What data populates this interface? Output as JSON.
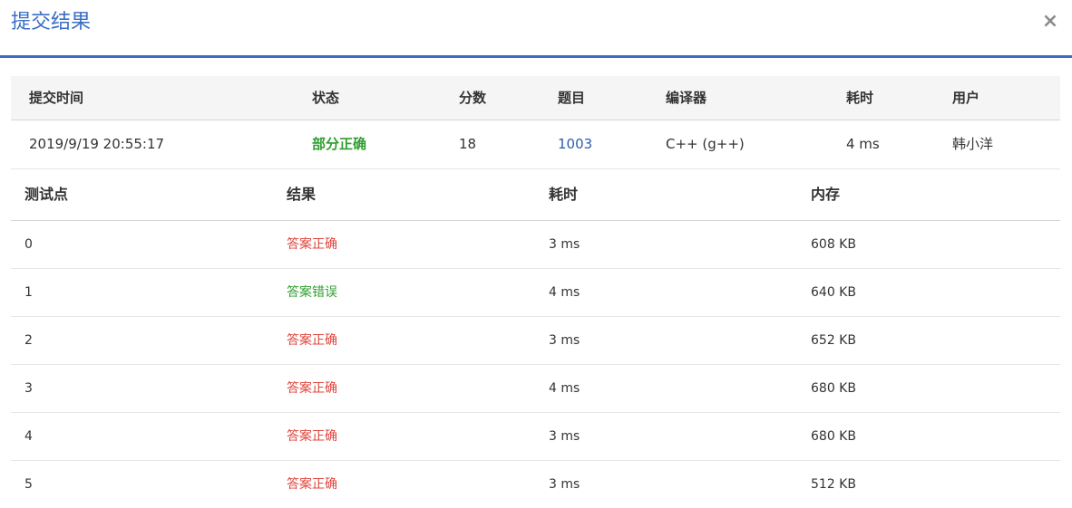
{
  "modal": {
    "title": "提交结果",
    "close": "×"
  },
  "summary": {
    "headers": [
      "提交时间",
      "状态",
      "分数",
      "题目",
      "编译器",
      "耗时",
      "用户"
    ],
    "row": {
      "time": "2019/9/19 20:55:17",
      "status": "部分正确",
      "score": "18",
      "problem": "1003",
      "compiler": "C++ (g++)",
      "elapsed": "4 ms",
      "user": "韩小洋"
    }
  },
  "cases": {
    "headers": [
      "测试点",
      "结果",
      "耗时",
      "内存"
    ],
    "rows": [
      {
        "id": "0",
        "result": "答案正确",
        "result_color": "#e0443b",
        "time": "3 ms",
        "memory": "608 KB"
      },
      {
        "id": "1",
        "result": "答案错误",
        "result_color": "#2f9e2f",
        "time": "4 ms",
        "memory": "640 KB"
      },
      {
        "id": "2",
        "result": "答案正确",
        "result_color": "#e0443b",
        "time": "3 ms",
        "memory": "652 KB"
      },
      {
        "id": "3",
        "result": "答案正确",
        "result_color": "#e0443b",
        "time": "4 ms",
        "memory": "680 KB"
      },
      {
        "id": "4",
        "result": "答案正确",
        "result_color": "#e0443b",
        "time": "3 ms",
        "memory": "680 KB"
      },
      {
        "id": "5",
        "result": "答案正确",
        "result_color": "#e0443b",
        "time": "3 ms",
        "memory": "512 KB"
      }
    ]
  },
  "colors": {
    "accent": "#3a6fc4",
    "status_partial": "#2f9e2f",
    "link": "#2b5ea8"
  }
}
